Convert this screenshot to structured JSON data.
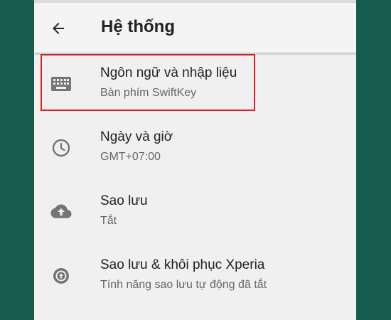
{
  "header": {
    "title": "Hệ thống",
    "back_icon": "arrow-back-icon"
  },
  "items": [
    {
      "icon": "keyboard-icon",
      "label": "Ngôn ngữ và nhập liệu",
      "sublabel": "Bàn phím SwiftKey",
      "highlighted": true
    },
    {
      "icon": "clock-icon",
      "label": "Ngày và giờ",
      "sublabel": "GMT+07:00"
    },
    {
      "icon": "cloud-upload-icon",
      "label": "Sao lưu",
      "sublabel": "Tắt"
    },
    {
      "icon": "backup-restore-icon",
      "label": "Sao lưu & khôi phục Xperia",
      "sublabel": "Tính năng sao lưu tự động đã tắt"
    }
  ],
  "colors": {
    "background": "#165c4e",
    "highlight_border": "#e02127",
    "icon": "#757575"
  }
}
